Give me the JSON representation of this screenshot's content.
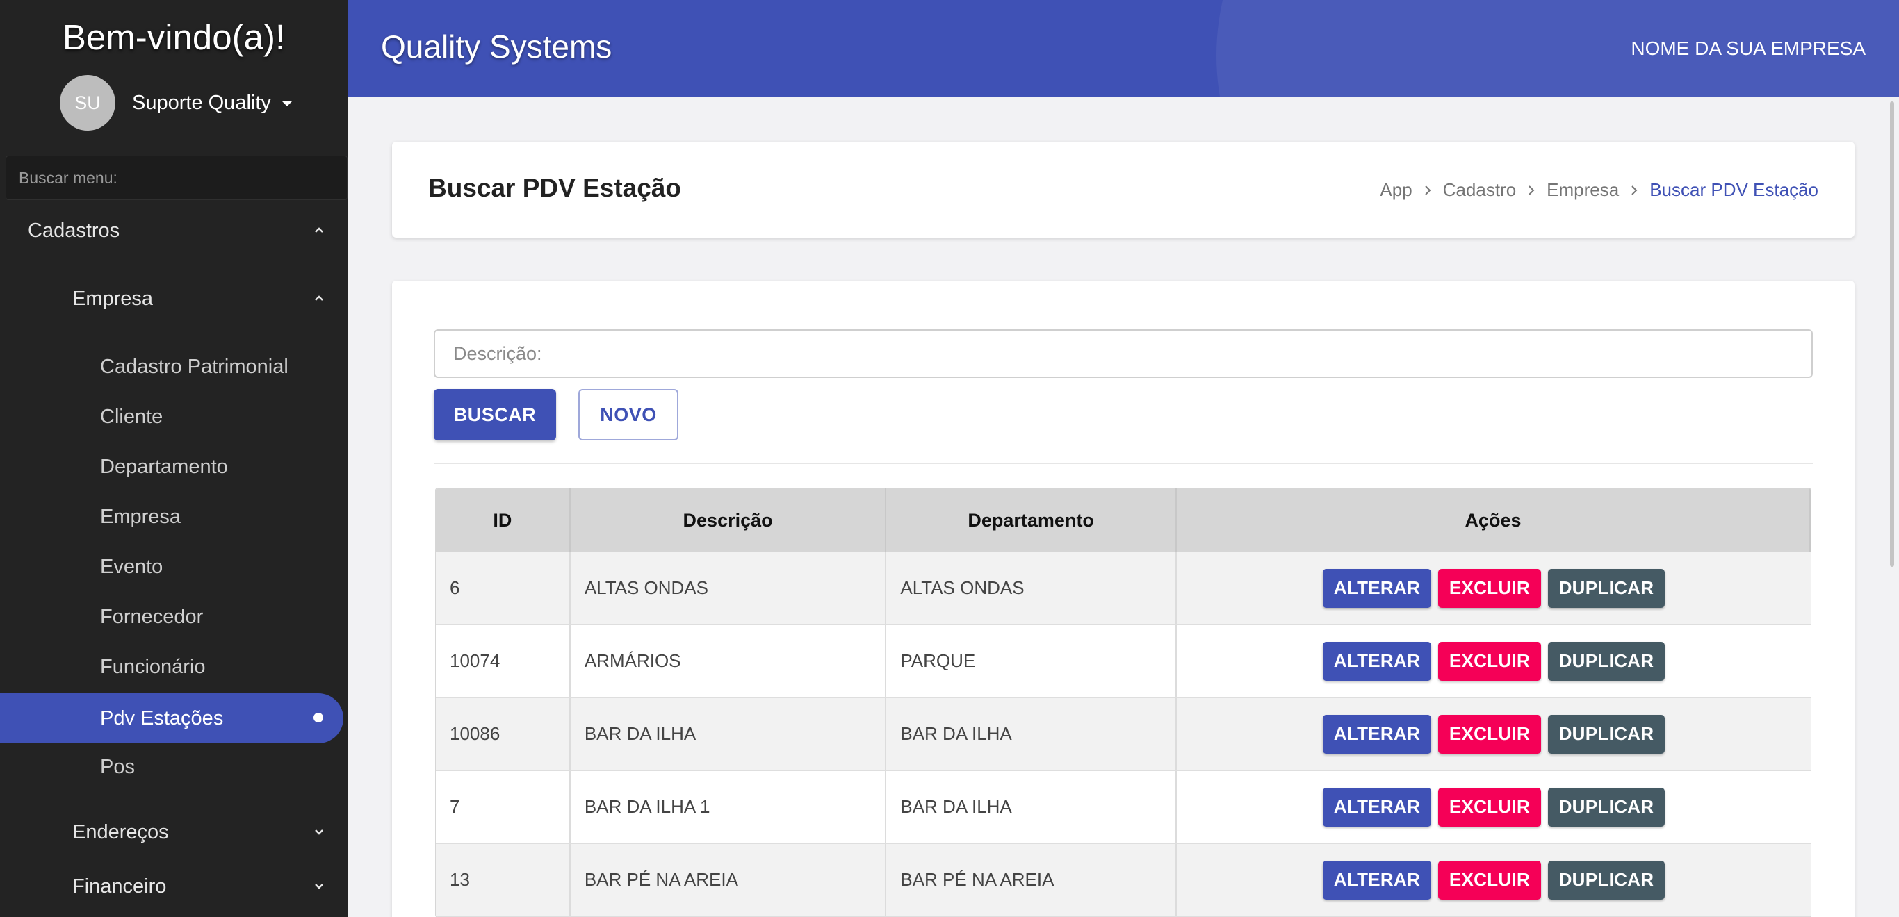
{
  "sidebar": {
    "welcome": "Bem-vindo(a)!",
    "user": {
      "initials": "SU",
      "name": "Suporte Quality"
    },
    "search_placeholder": "Buscar menu:",
    "sections": [
      {
        "label": "Cadastros",
        "expanded": true
      },
      {
        "label": "Empresa",
        "expanded": true
      },
      {
        "label": "Endereços",
        "expanded": false
      },
      {
        "label": "Financeiro",
        "expanded": false
      }
    ],
    "empresa_items": [
      "Cadastro Patrimonial",
      "Cliente",
      "Departamento",
      "Empresa",
      "Evento",
      "Fornecedor",
      "Funcionário",
      "Pdv Estações",
      "Pos"
    ],
    "active_item": "Pdv Estações"
  },
  "header": {
    "brand": "Quality Systems",
    "company": "NOME DA SUA EMPRESA"
  },
  "page": {
    "title": "Buscar PDV Estação",
    "breadcrumb": [
      "App",
      "Cadastro",
      "Empresa",
      "Buscar PDV Estação"
    ]
  },
  "search": {
    "description_placeholder": "Descrição:",
    "buscar_label": "BUSCAR",
    "novo_label": "NOVO"
  },
  "table": {
    "columns": [
      "ID",
      "Descrição",
      "Departamento",
      "Ações"
    ],
    "action_labels": {
      "alterar": "ALTERAR",
      "excluir": "EXCLUIR",
      "duplicar": "DUPLICAR"
    },
    "rows": [
      {
        "id": "6",
        "descricao": "ALTAS ONDAS",
        "departamento": "ALTAS ONDAS"
      },
      {
        "id": "10074",
        "descricao": "ARMÁRIOS",
        "departamento": "PARQUE"
      },
      {
        "id": "10086",
        "descricao": "BAR DA ILHA",
        "departamento": "BAR DA ILHA"
      },
      {
        "id": "7",
        "descricao": "BAR DA ILHA 1",
        "departamento": "BAR DA ILHA"
      },
      {
        "id": "13",
        "descricao": "BAR PÉ NA AREIA",
        "departamento": "BAR PÉ NA AREIA"
      }
    ]
  },
  "colors": {
    "primary": "#3f51b5",
    "danger": "#f50057",
    "secondary": "#455a64",
    "sidebar_bg": "#232323"
  }
}
